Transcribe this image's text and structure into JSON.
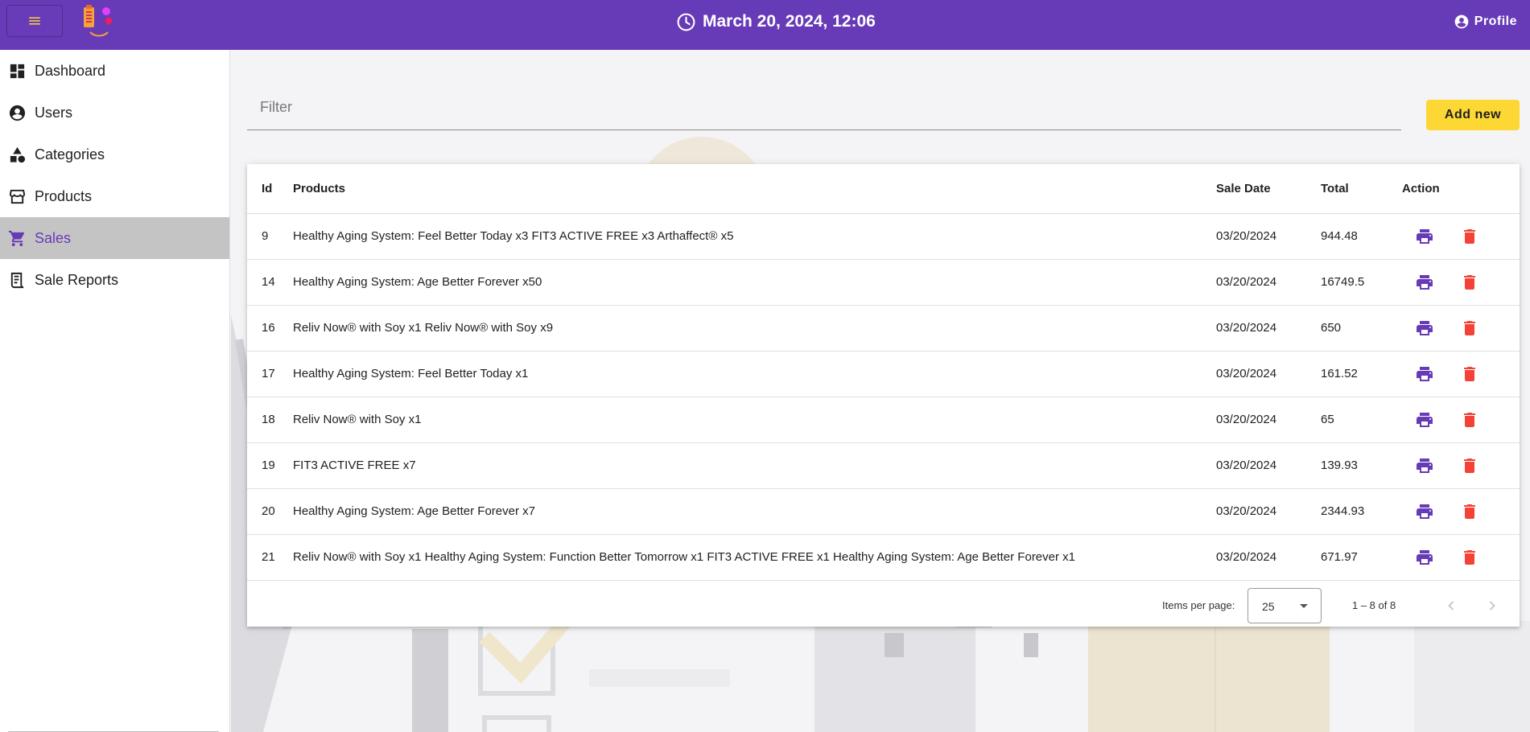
{
  "header": {
    "datetime": "March 20, 2024, 12:06",
    "profile_label": "Profile"
  },
  "sidebar": {
    "items": [
      {
        "label": "Dashboard",
        "icon": "dashboard-icon"
      },
      {
        "label": "Users",
        "icon": "account-circle-icon"
      },
      {
        "label": "Categories",
        "icon": "category-shapes-icon"
      },
      {
        "label": "Products",
        "icon": "storefront-icon"
      },
      {
        "label": "Sales",
        "icon": "shopping-cart-icon",
        "active": true
      },
      {
        "label": "Sale Reports",
        "icon": "receipt-icon"
      }
    ]
  },
  "filter": {
    "placeholder": "Filter",
    "value": ""
  },
  "add_button_label": "Add new",
  "table": {
    "columns": [
      "Id",
      "Products",
      "Sale Date",
      "Total",
      "Action"
    ],
    "rows": [
      {
        "id": "9",
        "products": "Healthy Aging System: Feel Better Today x3 FIT3 ACTIVE FREE x3 Arthaffect® x5",
        "date": "03/20/2024",
        "total": "944.48"
      },
      {
        "id": "14",
        "products": "Healthy Aging System: Age Better Forever x50",
        "date": "03/20/2024",
        "total": "16749.5"
      },
      {
        "id": "16",
        "products": "Reliv Now® with Soy x1 Reliv Now® with Soy x9",
        "date": "03/20/2024",
        "total": "650"
      },
      {
        "id": "17",
        "products": "Healthy Aging System: Feel Better Today x1",
        "date": "03/20/2024",
        "total": "161.52"
      },
      {
        "id": "18",
        "products": "Reliv Now® with Soy x1",
        "date": "03/20/2024",
        "total": "65"
      },
      {
        "id": "19",
        "products": "FIT3 ACTIVE FREE x7",
        "date": "03/20/2024",
        "total": "139.93"
      },
      {
        "id": "20",
        "products": "Healthy Aging System: Age Better Forever x7",
        "date": "03/20/2024",
        "total": "2344.93"
      },
      {
        "id": "21",
        "products": "Reliv Now® with Soy x1 Healthy Aging System: Function Better Tomorrow x1 FIT3 ACTIVE FREE x1 Healthy Aging System: Age Better Forever x1",
        "date": "03/20/2024",
        "total": "671.97"
      }
    ]
  },
  "paginator": {
    "items_per_page_label": "Items per page:",
    "page_size": "25",
    "range_label": "1 – 8 of 8"
  },
  "colors": {
    "primary": "#673ab7",
    "accent": "#fdd835",
    "danger": "#f44336",
    "active_nav_bg": "#c4c4c4"
  }
}
